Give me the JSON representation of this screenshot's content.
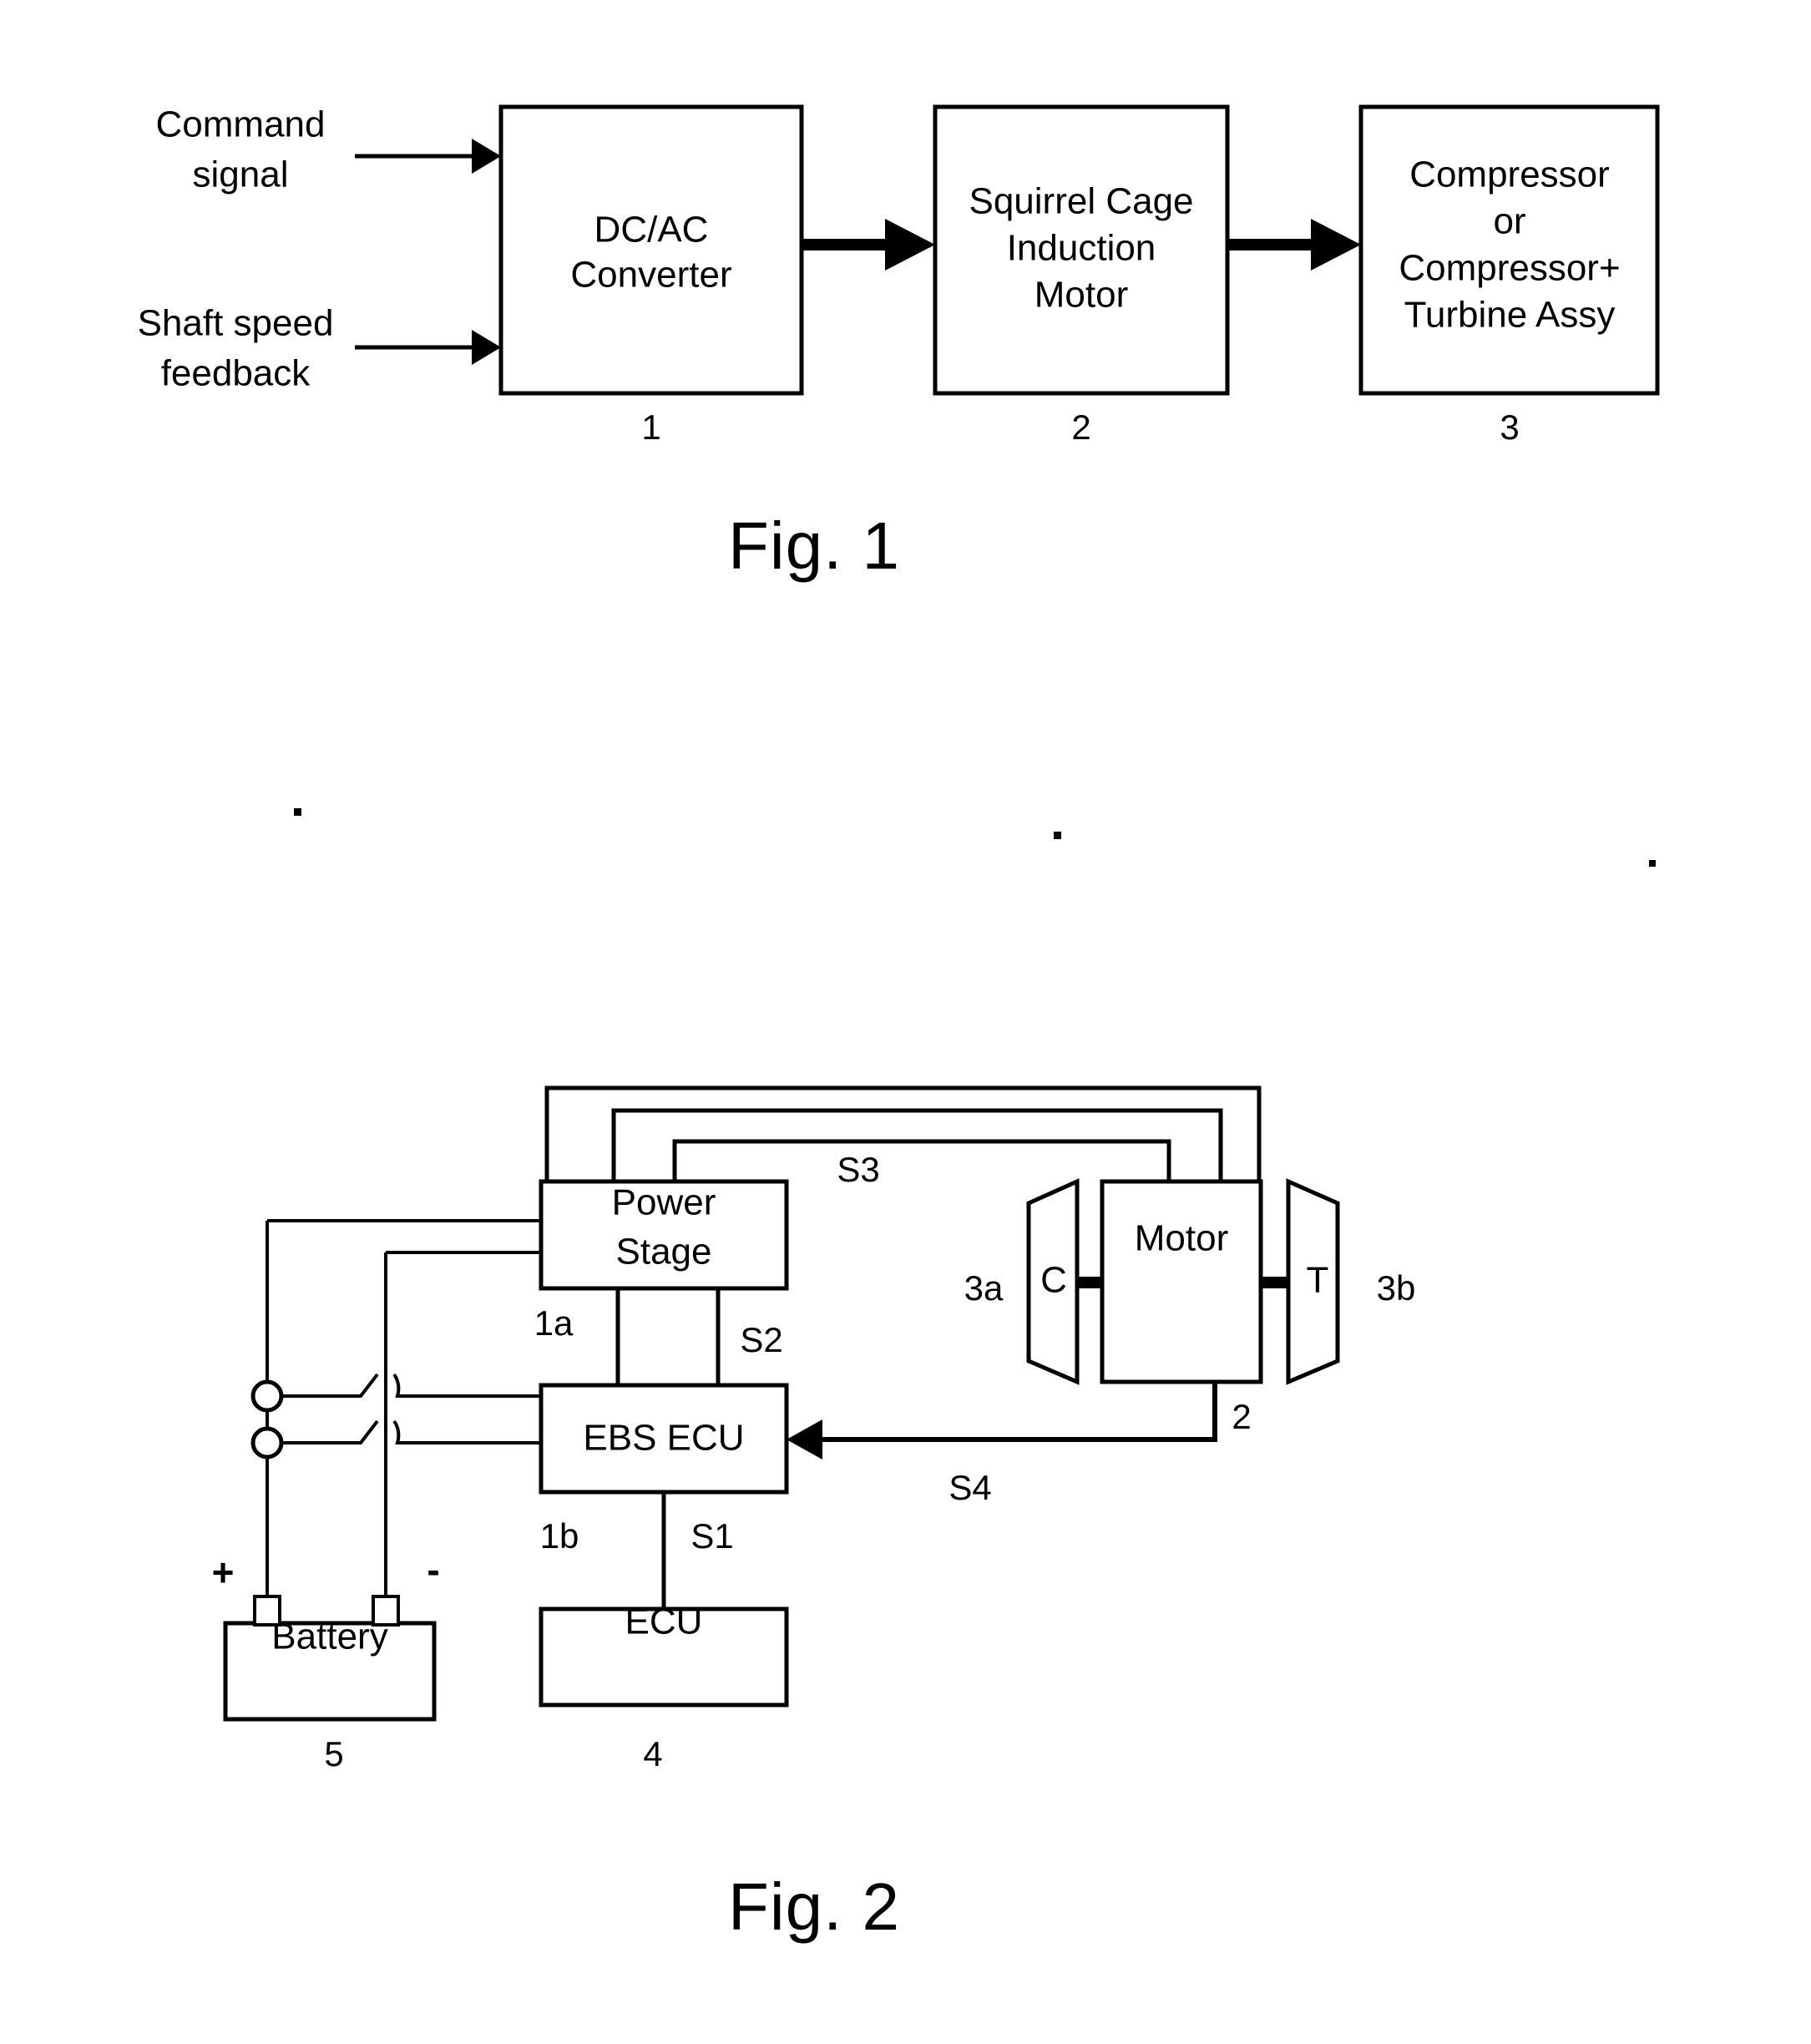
{
  "page": {
    "background": "#ffffff",
    "ink": "#000000"
  },
  "figure1": {
    "caption": "Fig. 1",
    "inputs": [
      {
        "line1": "Command",
        "line2": "signal"
      },
      {
        "line1": "Shaft speed",
        "line2": "feedback"
      }
    ],
    "blocks": [
      {
        "id": "converter",
        "lines": [
          "DC/AC",
          "Converter"
        ],
        "ref": "1"
      },
      {
        "id": "motor",
        "lines": [
          "Squirrel Cage",
          "Induction",
          "Motor"
        ],
        "ref": "2"
      },
      {
        "id": "load",
        "lines": [
          "Compressor",
          "or",
          "Compressor+",
          "Turbine Assy"
        ],
        "ref": "3"
      }
    ]
  },
  "figure2": {
    "caption": "Fig. 2",
    "blocks": [
      {
        "id": "power-stage",
        "lines": [
          "Power",
          "Stage"
        ],
        "ref": "1a"
      },
      {
        "id": "ebs-ecu",
        "lines": [
          "EBS ECU"
        ],
        "ref": "1b"
      },
      {
        "id": "ecu",
        "lines": [
          "ECU"
        ],
        "ref": "4"
      },
      {
        "id": "battery",
        "lines": [
          "Battery"
        ],
        "ref": "5"
      },
      {
        "id": "motor",
        "lines": [
          "Motor"
        ],
        "ref": "2"
      },
      {
        "id": "compressor",
        "lines": [
          "C"
        ],
        "ref": "3a"
      },
      {
        "id": "turbine",
        "lines": [
          "T"
        ],
        "ref": "3b"
      }
    ],
    "signals": [
      {
        "id": "s1",
        "label": "S1"
      },
      {
        "id": "s2",
        "label": "S2"
      },
      {
        "id": "s3",
        "label": "S3"
      },
      {
        "id": "s4",
        "label": "S4"
      }
    ],
    "battery_terminals": {
      "positive": "+",
      "negative": "-"
    }
  }
}
